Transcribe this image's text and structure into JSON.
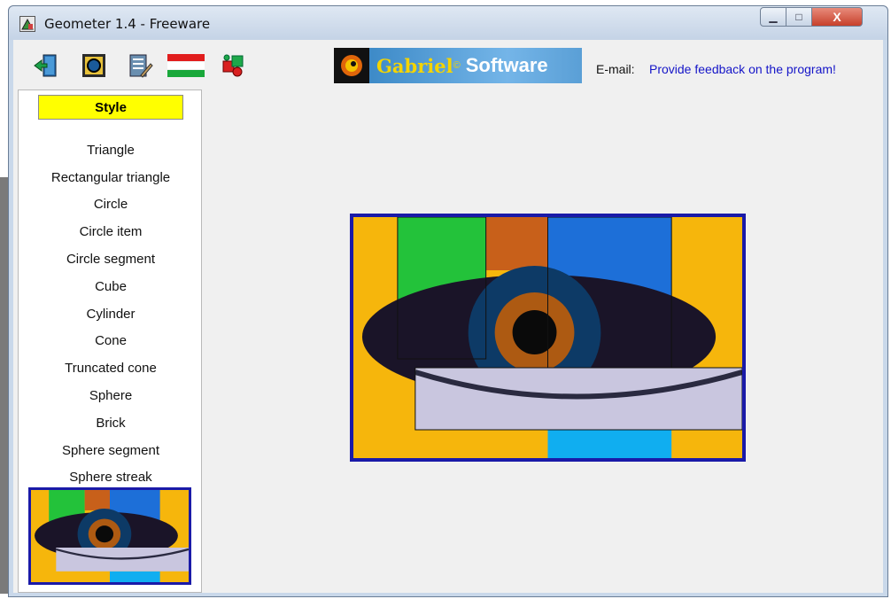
{
  "window": {
    "title": "Geometer 1.4 - Freeware",
    "controls": {
      "minimize": "▁",
      "maximize": "□",
      "close": "X"
    }
  },
  "toolbar": {
    "icons": [
      "exit-icon",
      "view-icon",
      "edit-icon",
      "hungarian-flag-icon",
      "puzzle-icon"
    ],
    "logo": {
      "name": "Gabriel",
      "suffix": "Software"
    },
    "email_label": "E-mail:",
    "feedback_link": "Provide feedback on the program!"
  },
  "sidebar": {
    "style_button": "Style",
    "shapes": [
      "Triangle",
      "Rectangular triangle",
      "Circle",
      "Circle item",
      "Circle segment",
      "Cube",
      "Cylinder",
      "Cone",
      "Truncated cone",
      "Sphere",
      "Brick",
      "Sphere segment",
      "Sphere streak"
    ]
  },
  "colors": {
    "style_button_bg": "#ffff00",
    "image_border": "#1a1aa8",
    "link": "#1515c8"
  }
}
